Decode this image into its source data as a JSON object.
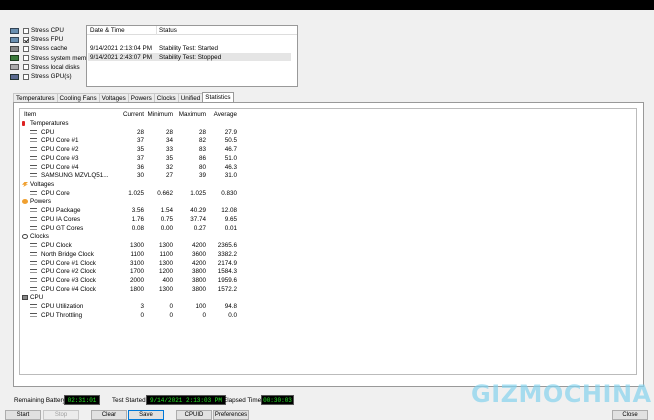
{
  "stress_options": [
    {
      "label": "Stress CPU",
      "checked": false,
      "icon": "cpu-chip-icon"
    },
    {
      "label": "Stress FPU",
      "checked": true,
      "icon": "fpu-chip-icon"
    },
    {
      "label": "Stress cache",
      "checked": false,
      "icon": "cache-chip-icon"
    },
    {
      "label": "Stress system memory",
      "checked": false,
      "icon": "memory-module-icon"
    },
    {
      "label": "Stress local disks",
      "checked": false,
      "icon": "disk-drive-icon"
    },
    {
      "label": "Stress GPU(s)",
      "checked": false,
      "icon": "gpu-card-icon"
    }
  ],
  "log": {
    "headers": [
      "Date & Time",
      "Status"
    ],
    "rows": [
      [
        "9/14/2021 2:13:04 PM",
        "Stability Test: Started"
      ],
      [
        "9/14/2021 2:43:07 PM",
        "Stability Test: Stopped"
      ]
    ]
  },
  "tabs": [
    "Temperatures",
    "Cooling Fans",
    "Voltages",
    "Powers",
    "Clocks",
    "Unified",
    "Statistics"
  ],
  "active_tab": "Statistics",
  "table": {
    "headers": [
      "Item",
      "Current",
      "Minimum",
      "Maximum",
      "Average"
    ],
    "groups": [
      {
        "name": "Temperatures",
        "icon": "thermometer-icon",
        "rows": [
          {
            "name": "CPU",
            "cur": "28",
            "min": "28",
            "max": "28",
            "avg": "27.9"
          },
          {
            "name": "CPU Core #1",
            "cur": "37",
            "min": "34",
            "max": "82",
            "avg": "50.5"
          },
          {
            "name": "CPU Core #2",
            "cur": "35",
            "min": "33",
            "max": "83",
            "avg": "46.7"
          },
          {
            "name": "CPU Core #3",
            "cur": "37",
            "min": "35",
            "max": "86",
            "avg": "51.0"
          },
          {
            "name": "CPU Core #4",
            "cur": "36",
            "min": "32",
            "max": "80",
            "avg": "46.3"
          },
          {
            "name": "SAMSUNG MZVLQ51...",
            "cur": "30",
            "min": "27",
            "max": "39",
            "avg": "31.0"
          }
        ]
      },
      {
        "name": "Voltages",
        "icon": "voltage-icon",
        "rows": [
          {
            "name": "CPU Core",
            "cur": "1.025",
            "min": "0.662",
            "max": "1.025",
            "avg": "0.830"
          }
        ]
      },
      {
        "name": "Powers",
        "icon": "power-icon",
        "rows": [
          {
            "name": "CPU Package",
            "cur": "3.56",
            "min": "1.54",
            "max": "40.29",
            "avg": "12.08"
          },
          {
            "name": "CPU IA Cores",
            "cur": "1.76",
            "min": "0.75",
            "max": "37.74",
            "avg": "9.65"
          },
          {
            "name": "CPU GT Cores",
            "cur": "0.08",
            "min": "0.00",
            "max": "0.27",
            "avg": "0.01"
          }
        ]
      },
      {
        "name": "Clocks",
        "icon": "clock-icon",
        "rows": [
          {
            "name": "CPU Clock",
            "cur": "1300",
            "min": "1300",
            "max": "4200",
            "avg": "2365.6"
          },
          {
            "name": "North Bridge Clock",
            "cur": "1100",
            "min": "1100",
            "max": "3600",
            "avg": "3382.2"
          },
          {
            "name": "CPU Core #1 Clock",
            "cur": "3100",
            "min": "1300",
            "max": "4200",
            "avg": "2174.9"
          },
          {
            "name": "CPU Core #2 Clock",
            "cur": "1700",
            "min": "1200",
            "max": "3800",
            "avg": "1584.3"
          },
          {
            "name": "CPU Core #3 Clock",
            "cur": "2000",
            "min": "400",
            "max": "3800",
            "avg": "1959.6"
          },
          {
            "name": "CPU Core #4 Clock",
            "cur": "1800",
            "min": "1300",
            "max": "3800",
            "avg": "1572.2"
          }
        ]
      },
      {
        "name": "CPU",
        "icon": "cpu-icon",
        "rows": [
          {
            "name": "CPU Utilization",
            "cur": "3",
            "min": "0",
            "max": "100",
            "avg": "94.8"
          },
          {
            "name": "CPU Throttling",
            "cur": "0",
            "min": "0",
            "max": "0",
            "avg": "0.0"
          }
        ]
      }
    ]
  },
  "status": {
    "battery_label": "Remaining Battery:",
    "battery_value": "02:31:01",
    "started_label": "Test Started:",
    "started_value": "9/14/2021 2:13:03 PM",
    "elapsed_label": "Elapsed Time:",
    "elapsed_value": "00:30:03"
  },
  "buttons": {
    "start": "Start",
    "stop": "Stop",
    "clear": "Clear",
    "save": "Save",
    "cpuid": "CPUID",
    "preferences": "Preferences",
    "close": "Close"
  },
  "watermark": "GIZMOCHINA",
  "colors": {
    "lcd_text": "#27e627",
    "watermark": "#86d3ee",
    "thermo_red": "#d22",
    "bolt_orange": "#f0a030"
  }
}
